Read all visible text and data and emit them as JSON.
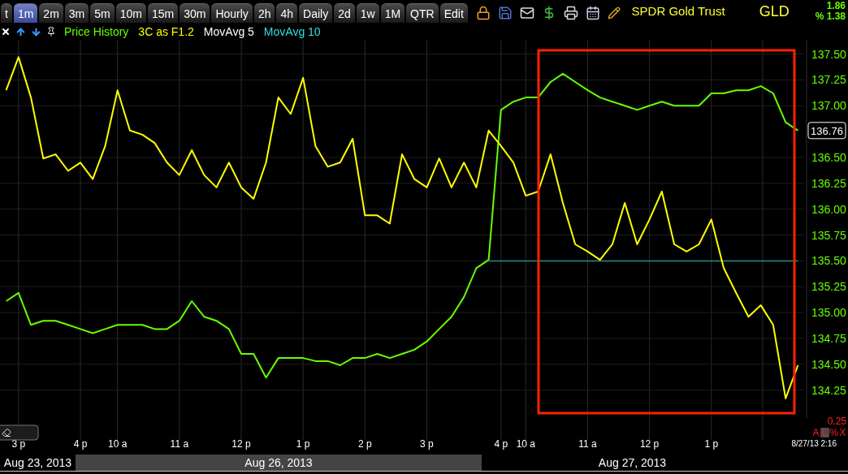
{
  "tabs": [
    {
      "label": "t",
      "selected": false
    },
    {
      "label": "1m",
      "selected": true
    },
    {
      "label": "2m",
      "selected": false
    },
    {
      "label": "3m",
      "selected": false
    },
    {
      "label": "5m",
      "selected": false
    },
    {
      "label": "10m",
      "selected": false
    },
    {
      "label": "15m",
      "selected": false
    },
    {
      "label": "30m",
      "selected": false
    },
    {
      "label": "Hourly",
      "selected": false
    },
    {
      "label": "2h",
      "selected": false
    },
    {
      "label": "4h",
      "selected": false
    },
    {
      "label": "Daily",
      "selected": false
    },
    {
      "label": "2d",
      "selected": false
    },
    {
      "label": "1w",
      "selected": false
    },
    {
      "label": "1M",
      "selected": false
    },
    {
      "label": "QTR",
      "selected": false
    },
    {
      "label": "Edit",
      "selected": false
    }
  ],
  "legend": [
    {
      "label": "Price History",
      "color": "#66ff00"
    },
    {
      "label": "3C as F1.2",
      "color": "#ffff00"
    },
    {
      "label": "MovAvg 5",
      "color": "#ffffff"
    },
    {
      "label": "MovAvg 10",
      "color": "#33dddd"
    }
  ],
  "instrument": {
    "name": "SPDR Gold Trust",
    "symbol": "GLD",
    "change": "1.86",
    "change_percent": "% 1.38"
  },
  "chart": {
    "last_price": "136.76",
    "scale_reading": "0.25",
    "timestamp": "8/27/13 2:16",
    "scale_buttons": [
      {
        "label": "A",
        "selected": false
      },
      {
        "label": "L",
        "selected": true
      },
      {
        "label": "%",
        "selected": false
      },
      {
        "label": "X",
        "selected": false
      }
    ],
    "chart_data": {
      "type": "line",
      "categories": [
        null,
        "3 p",
        null,
        null,
        null,
        null,
        "4 p",
        null,
        null,
        "10 a",
        null,
        null,
        null,
        null,
        "11 a",
        null,
        null,
        null,
        null,
        "12 p",
        null,
        null,
        null,
        null,
        "1 p",
        null,
        null,
        null,
        null,
        "2 p",
        null,
        null,
        null,
        null,
        "3 p",
        null,
        null,
        null,
        null,
        null,
        "4 p",
        null,
        "10 a",
        null,
        null,
        null,
        null,
        "11 a",
        null,
        null,
        null,
        null,
        "12 p",
        null,
        null,
        null,
        null,
        "1 p",
        null,
        null,
        null,
        null,
        null,
        null,
        null
      ],
      "grid": true,
      "ylim": [
        133.98,
        137.63
      ],
      "yticks": [
        {
          "value": 137.5,
          "label": "137.50"
        },
        {
          "value": 137.25,
          "label": "137.25"
        },
        {
          "value": 137,
          "label": "137.00"
        },
        {
          "value": 136.5,
          "label": "136.50"
        },
        {
          "value": 136.25,
          "label": "136.25"
        },
        {
          "value": 136,
          "label": "136.00"
        },
        {
          "value": 135.75,
          "label": "135.75"
        },
        {
          "value": 135.5,
          "label": "135.50"
        },
        {
          "value": 135.25,
          "label": "135.25"
        },
        {
          "value": 135,
          "label": "135.00"
        },
        {
          "value": 134.75,
          "label": "134.75"
        },
        {
          "value": 134.5,
          "label": "134.50"
        },
        {
          "value": 134.25,
          "label": "134.25"
        }
      ],
      "series": [
        {
          "color": "#66ff00",
          "values": [
            135.11,
            135.19,
            134.88,
            134.92,
            134.92,
            134.88,
            134.84,
            134.8,
            134.84,
            134.88,
            134.88,
            134.88,
            134.84,
            134.84,
            134.92,
            135.11,
            134.96,
            134.92,
            134.84,
            134.6,
            134.6,
            134.37,
            134.56,
            134.56,
            134.56,
            134.53,
            134.53,
            134.49,
            134.56,
            134.56,
            134.6,
            134.56,
            134.6,
            134.64,
            134.72,
            134.84,
            134.96,
            135.15,
            135.43,
            135.51,
            136.96,
            137.04,
            137.08,
            137.08,
            137.23,
            137.31,
            137.23,
            137.15,
            137.08,
            137.04,
            137,
            136.96,
            137,
            137.04,
            137,
            137,
            137,
            137.12,
            137.12,
            137.15,
            137.15,
            137.19,
            137.12,
            136.84,
            136.76
          ]
        },
        {
          "color": "#2a8a8a",
          "values": [
            null,
            null,
            null,
            null,
            null,
            null,
            null,
            null,
            null,
            null,
            null,
            null,
            null,
            null,
            null,
            null,
            null,
            null,
            null,
            null,
            null,
            null,
            null,
            null,
            null,
            null,
            null,
            null,
            null,
            null,
            null,
            null,
            null,
            null,
            null,
            null,
            null,
            null,
            null,
            135.5,
            135.5,
            135.5,
            135.5,
            135.5,
            135.5,
            135.5,
            135.5,
            135.5,
            135.5,
            135.5,
            135.5,
            135.5,
            135.5,
            135.5,
            135.5,
            135.5,
            135.5,
            135.5,
            135.5,
            135.5,
            135.5,
            135.5,
            135.5,
            135.5,
            135.5
          ]
        },
        {
          "color": "#ffff00",
          "values": [
            137.15,
            137.47,
            137.08,
            136.49,
            136.53,
            136.37,
            136.45,
            136.29,
            136.61,
            137.15,
            136.76,
            136.72,
            136.64,
            136.45,
            136.33,
            136.57,
            136.33,
            136.21,
            136.45,
            136.21,
            136.1,
            136.45,
            137.08,
            136.92,
            137.27,
            136.61,
            136.41,
            136.45,
            136.68,
            135.94,
            135.94,
            135.86,
            136.53,
            136.29,
            136.21,
            136.49,
            136.21,
            136.45,
            136.21,
            136.76,
            136.61,
            136.45,
            136.13,
            136.17,
            136.53,
            136.06,
            135.66,
            135.59,
            135.51,
            135.66,
            136.06,
            135.66,
            135.9,
            136.17,
            135.66,
            135.59,
            135.66,
            135.9,
            135.43,
            135.19,
            134.96,
            135.07,
            134.88,
            134.17,
            134.49
          ]
        }
      ]
    }
  },
  "date_bands": [
    "Aug 23, 2013",
    "Aug 26, 2013",
    "Aug 27, 2013"
  ]
}
